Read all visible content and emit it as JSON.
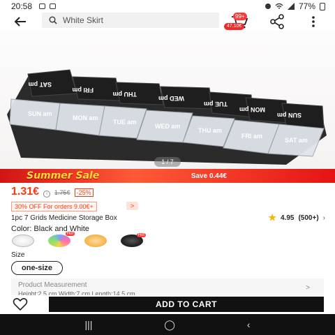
{
  "status": {
    "time": "20:58",
    "battery": "77%"
  },
  "header": {
    "search_text": "White Skirt",
    "cart_count": "99+",
    "cart_price": "47.10€"
  },
  "gallery": {
    "pager": "1 / 7"
  },
  "product_photo": {
    "labels_top": [
      "SAT pm",
      "FRI pm",
      "THU pm",
      "WED pm",
      "TUE pm",
      "MON pm",
      "SUN pm"
    ],
    "labels_bottom": [
      "SUN am",
      "MON am",
      "TUE am",
      "WED am",
      "THU am",
      "FRI am",
      "SAT am"
    ]
  },
  "banner": {
    "title": "Summer Sale",
    "save": "Save 0.44€"
  },
  "price": {
    "current": "1.31€",
    "original": "1.75€",
    "discount": "-25%"
  },
  "coupon": {
    "text": "30% OFF For orders 9.00€+",
    "arrow": ">"
  },
  "product": {
    "title": "1pc 7 Grids Medicine Storage Box",
    "rating": "4.95",
    "reviews": "(500+)"
  },
  "color": {
    "label": "Color: Black and White",
    "hot_badge": "Hot"
  },
  "size": {
    "label": "Size",
    "option": "one-size"
  },
  "measurement": {
    "title": "Product Measurement",
    "detail": "Height:2.5 cm  Width:7 cm  Length:14.5 cm",
    "chevron": ">"
  },
  "actions": {
    "add_to_cart": "ADD TO CART"
  },
  "colors": {
    "accent": "#fa3a0c",
    "banner": "#e41414",
    "button": "#111111"
  }
}
